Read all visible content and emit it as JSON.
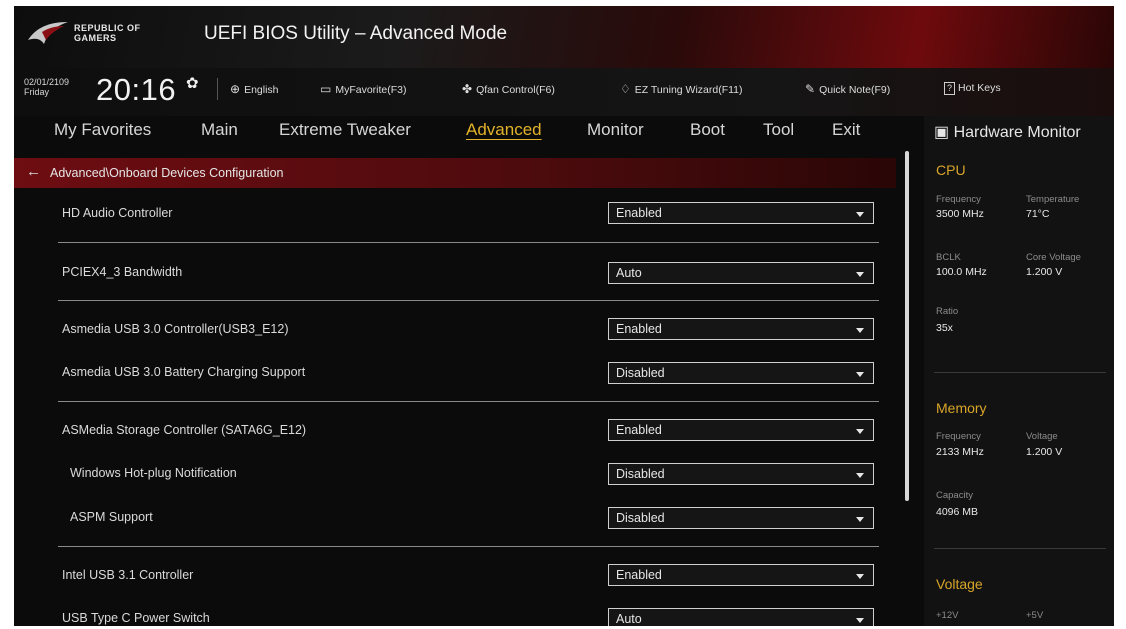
{
  "brand": {
    "line1": "REPUBLIC OF",
    "line2": "GAMERS"
  },
  "window": {
    "title": "UEFI BIOS Utility – Advanced Mode"
  },
  "infobar": {
    "date": "02/01/2109",
    "day": "Friday",
    "time": "20:16",
    "items": [
      {
        "icon": "globe-icon",
        "label": "English"
      },
      {
        "icon": "myfavorite-icon",
        "label": "MyFavorite(F3)"
      },
      {
        "icon": "fan-icon",
        "label": "Qfan Control(F6)"
      },
      {
        "icon": "lightbulb-icon",
        "label": "EZ Tuning Wizard(F11)"
      },
      {
        "icon": "note-icon",
        "label": "Quick Note(F9)"
      },
      {
        "icon": "help-icon",
        "label": "Hot Keys",
        "box": "?"
      }
    ]
  },
  "tabs": [
    {
      "label": "My Favorites"
    },
    {
      "label": "Main"
    },
    {
      "label": "Extreme Tweaker"
    },
    {
      "label": "Advanced",
      "active": true
    },
    {
      "label": "Monitor"
    },
    {
      "label": "Boot"
    },
    {
      "label": "Tool"
    },
    {
      "label": "Exit"
    }
  ],
  "breadcrumb": "Advanced\\Onboard Devices Configuration",
  "settings": [
    {
      "label": "HD Audio Controller",
      "value": "Enabled"
    },
    {
      "label": "PCIEX4_3 Bandwidth",
      "value": "Auto"
    },
    {
      "label": "Asmedia USB 3.0 Controller(USB3_E12)",
      "value": "Enabled"
    },
    {
      "label": "Asmedia USB 3.0 Battery Charging Support",
      "value": "Disabled"
    },
    {
      "label": "ASMedia Storage Controller (SATA6G_E12)",
      "value": "Enabled"
    },
    {
      "label": "Windows Hot-plug Notification",
      "value": "Disabled"
    },
    {
      "label": "ASPM Support",
      "value": "Disabled"
    },
    {
      "label": "Intel USB 3.1 Controller",
      "value": "Enabled"
    },
    {
      "label": "USB Type C Power Switch",
      "value": "Auto"
    }
  ],
  "hardware_monitor": {
    "title": "Hardware Monitor",
    "cpu": {
      "heading": "CPU",
      "frequency_label": "Frequency",
      "frequency": "3500 MHz",
      "temperature_label": "Temperature",
      "temperature": "71°C",
      "bclk_label": "BCLK",
      "bclk": "100.0 MHz",
      "core_voltage_label": "Core Voltage",
      "core_voltage": "1.200 V",
      "ratio_label": "Ratio",
      "ratio": "35x"
    },
    "memory": {
      "heading": "Memory",
      "frequency_label": "Frequency",
      "frequency": "2133 MHz",
      "voltage_label": "Voltage",
      "voltage": "1.200 V",
      "capacity_label": "Capacity",
      "capacity": "4096 MB"
    },
    "voltage": {
      "heading": "Voltage",
      "v12_label": "+12V",
      "v5_label": "+5V"
    }
  },
  "colors": {
    "accent": "#e2b22a",
    "header_red": "#6e0d12",
    "background": "#0b0b0b"
  }
}
